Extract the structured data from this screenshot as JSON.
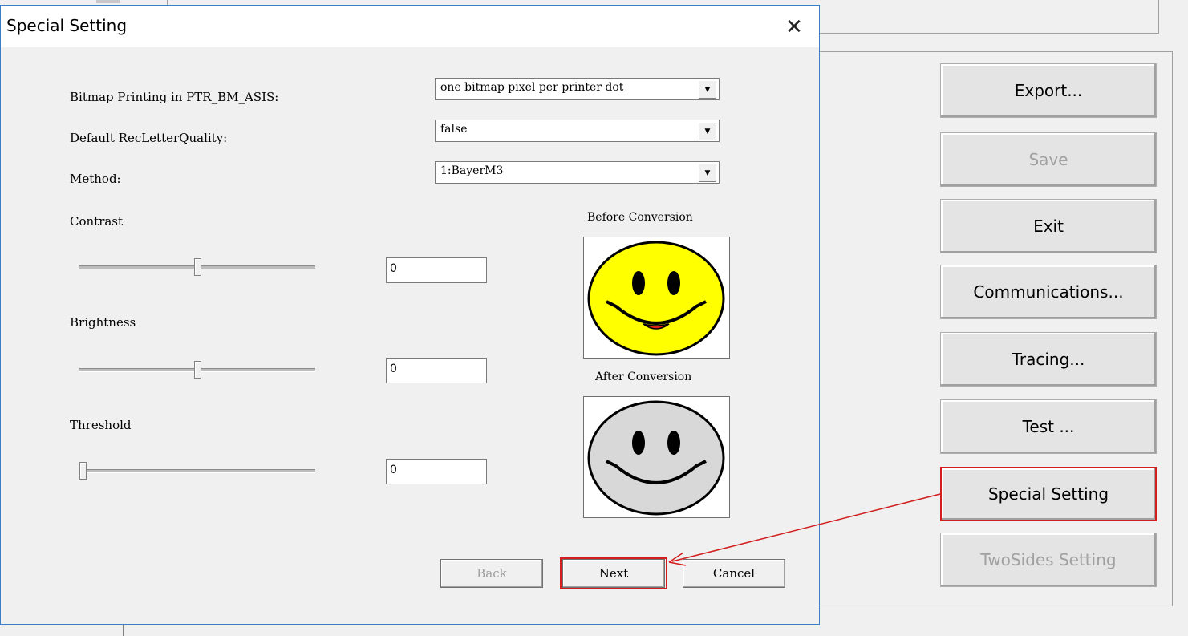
{
  "dialog": {
    "title": "Special Setting",
    "close_glyph": "✕",
    "fields": {
      "bitmap_label": "Bitmap Printing in PTR_BM_ASIS:",
      "bitmap_value": "one bitmap pixel per printer dot",
      "recletter_label": "Default RecLetterQuality:",
      "recletter_value": "false",
      "method_label": "Method:",
      "method_value": "1:BayerM3"
    },
    "sliders": {
      "contrast_label": "Contrast",
      "contrast_value": "0",
      "contrast_level": 0.5,
      "brightness_label": "Brightness",
      "brightness_value": "0",
      "brightness_level": 0.5,
      "threshold_label": "Threshold",
      "threshold_value": "0",
      "threshold_level": 0.0
    },
    "preview": {
      "before_label": "Before Conversion",
      "after_label": "After Conversion"
    },
    "buttons": {
      "back": "Back",
      "next": "Next",
      "cancel": "Cancel"
    }
  },
  "side_buttons": [
    {
      "label": "Export...",
      "enabled": true
    },
    {
      "label": "Save",
      "enabled": false
    },
    {
      "label": "Exit",
      "enabled": true
    },
    {
      "label": "Communications...",
      "enabled": true
    },
    {
      "label": "Tracing...",
      "enabled": true
    },
    {
      "label": "Test ...",
      "enabled": true
    },
    {
      "label": "Special Setting",
      "enabled": true,
      "highlighted": true
    },
    {
      "label": "TwoSides Setting",
      "enabled": false
    }
  ],
  "colors": {
    "highlight": "#d21e1e",
    "dialog_border": "#3c7fc6",
    "smiley_before": "#ffff00",
    "smiley_after": "#d8d8d8"
  }
}
